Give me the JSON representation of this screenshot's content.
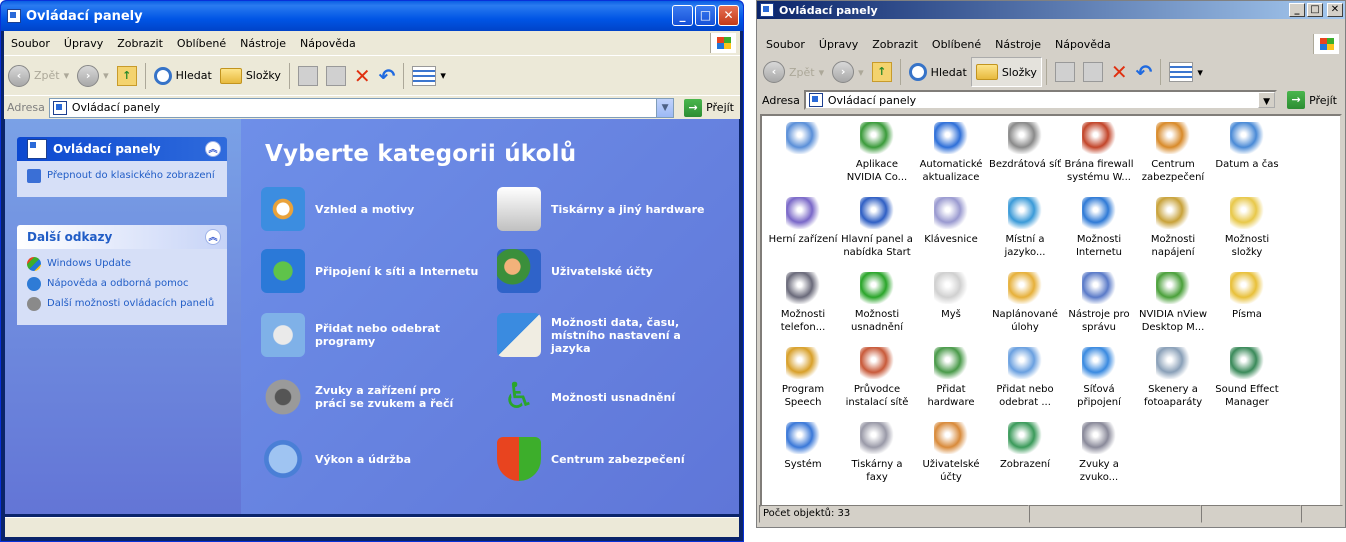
{
  "left": {
    "title": "Ovládací panely",
    "menu": [
      "Soubor",
      "Úpravy",
      "Zobrazit",
      "Oblíbené",
      "Nástroje",
      "Nápověda"
    ],
    "toolbar": {
      "back": "Zpět",
      "search": "Hledat",
      "folders": "Složky"
    },
    "address_label": "Adresa",
    "address": "Ovládací panely",
    "go": "Přejít",
    "pane": {
      "cp_title": "Ovládací panely",
      "cp_link": "Přepnout do klasického zobrazení",
      "more_title": "Další odkazy",
      "links": [
        "Windows Update",
        "Nápověda a odborná pomoc",
        "Další možnosti ovládacích panelů"
      ]
    },
    "heading": "Vyberte kategorii úkolů",
    "categories": [
      "Vzhled a motivy",
      "Tiskárny a jiný hardware",
      "Připojení k síti a Internetu",
      "Uživatelské účty",
      "Přidat nebo odebrat programy",
      "Možnosti data, času, místního nastavení a jazyka",
      "Zvuky a zařízení pro práci se zvukem a řečí",
      "Možnosti usnadnění",
      "Výkon a údržba",
      "Centrum zabezpečení"
    ]
  },
  "right": {
    "title": "Ovládací panely",
    "menu": [
      "Soubor",
      "Úpravy",
      "Zobrazit",
      "Oblíbené",
      "Nástroje",
      "Nápověda"
    ],
    "toolbar": {
      "back": "Zpět",
      "search": "Hledat",
      "folders": "Složky"
    },
    "address_label": "Adresa",
    "address": "Ovládací panely",
    "go": "Přejít",
    "items": [
      "",
      "Aplikace NVIDIA Co...",
      "Automatické aktualizace",
      "Bezdrátová síť",
      "Brána firewall systému W...",
      "Centrum zabezpečení",
      "Datum a čas",
      "Herní zařízení",
      "Hlavní panel a nabídka Start",
      "Klávesnice",
      "Místní a jazyko...",
      "Možnosti Internetu",
      "Možnosti napájení",
      "Možnosti složky",
      "Možnosti telefon...",
      "Možnosti usnadnění",
      "Myš",
      "Naplánované úlohy",
      "Nástroje pro správu",
      "NVIDIA nView Desktop M...",
      "Písma",
      "Program Speech",
      "Průvodce instalací sítě",
      "Přidat hardware",
      "Přidat nebo odebrat ...",
      "Síťová připojení",
      "Skenery a fotoaparáty",
      "Sound Effect Manager",
      "Systém",
      "Tiskárny a faxy",
      "Uživatelské účty",
      "Zobrazení",
      "Zvuky a zvuko..."
    ],
    "status": "Počet objektů: 33"
  },
  "colors": {
    "xp_blue": "#0055e5",
    "task_pane": "#d6dff7",
    "link": "#215dc6"
  }
}
